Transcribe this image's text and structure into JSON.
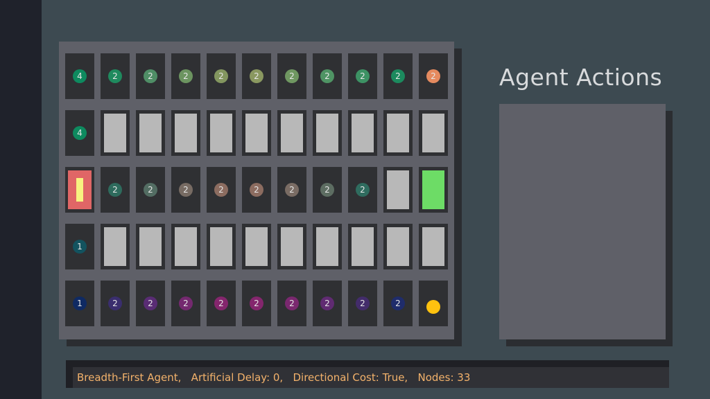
{
  "panel": {
    "title": "Agent Actions"
  },
  "status": {
    "text": "Breadth-First Agent,   Artificial Delay: 0,   Directional Cost: True,   Nodes: 33"
  },
  "grid": {
    "rows": [
      [
        {
          "type": "badge",
          "value": "4",
          "color": "#0e8a5f"
        },
        {
          "type": "badge",
          "value": "2",
          "color": "#1f8a5e"
        },
        {
          "type": "badge",
          "value": "2",
          "color": "#4f8e66"
        },
        {
          "type": "badge",
          "value": "2",
          "color": "#6c9460"
        },
        {
          "type": "badge",
          "value": "2",
          "color": "#83965f"
        },
        {
          "type": "badge",
          "value": "2",
          "color": "#8a9860"
        },
        {
          "type": "badge",
          "value": "2",
          "color": "#6f9761"
        },
        {
          "type": "badge",
          "value": "2",
          "color": "#4f9464"
        },
        {
          "type": "badge",
          "value": "2",
          "color": "#3d9264"
        },
        {
          "type": "badge",
          "value": "2",
          "color": "#1c8a5e"
        },
        {
          "type": "badge",
          "value": "2",
          "color": "#e58a5f"
        }
      ],
      [
        {
          "type": "badge",
          "value": "4",
          "color": "#0e8a5f"
        },
        {
          "type": "block"
        },
        {
          "type": "block"
        },
        {
          "type": "block"
        },
        {
          "type": "block"
        },
        {
          "type": "block"
        },
        {
          "type": "block"
        },
        {
          "type": "block"
        },
        {
          "type": "block"
        },
        {
          "type": "block"
        },
        {
          "type": "block"
        }
      ],
      [
        {
          "type": "agent"
        },
        {
          "type": "badge",
          "value": "2",
          "color": "#2e6b5d"
        },
        {
          "type": "badge",
          "value": "2",
          "color": "#536d63"
        },
        {
          "type": "badge",
          "value": "2",
          "color": "#776b63"
        },
        {
          "type": "badge",
          "value": "2",
          "color": "#8c6c60"
        },
        {
          "type": "badge",
          "value": "2",
          "color": "#8c6c60"
        },
        {
          "type": "badge",
          "value": "2",
          "color": "#7a6c64"
        },
        {
          "type": "badge",
          "value": "2",
          "color": "#5d6d62"
        },
        {
          "type": "badge",
          "value": "2",
          "color": "#2f6c5f"
        },
        {
          "type": "block"
        },
        {
          "type": "goal",
          "color": "#6ddc66"
        }
      ],
      [
        {
          "type": "badge",
          "value": "1",
          "color": "#13535f"
        },
        {
          "type": "block"
        },
        {
          "type": "block"
        },
        {
          "type": "block"
        },
        {
          "type": "block"
        },
        {
          "type": "block"
        },
        {
          "type": "block"
        },
        {
          "type": "block"
        },
        {
          "type": "block"
        },
        {
          "type": "block"
        },
        {
          "type": "block"
        }
      ],
      [
        {
          "type": "badge",
          "value": "1",
          "color": "#0f2a63"
        },
        {
          "type": "badge",
          "value": "2",
          "color": "#3a2e6e"
        },
        {
          "type": "badge",
          "value": "2",
          "color": "#592c74"
        },
        {
          "type": "badge",
          "value": "2",
          "color": "#74296f"
        },
        {
          "type": "badge",
          "value": "2",
          "color": "#84266d"
        },
        {
          "type": "badge",
          "value": "2",
          "color": "#84266d"
        },
        {
          "type": "badge",
          "value": "2",
          "color": "#7a286f"
        },
        {
          "type": "badge",
          "value": "2",
          "color": "#602b72"
        },
        {
          "type": "badge",
          "value": "2",
          "color": "#432c6b"
        },
        {
          "type": "badge",
          "value": "2",
          "color": "#1f2c6b"
        },
        {
          "type": "coin",
          "color": "#ffc20f"
        }
      ]
    ]
  }
}
